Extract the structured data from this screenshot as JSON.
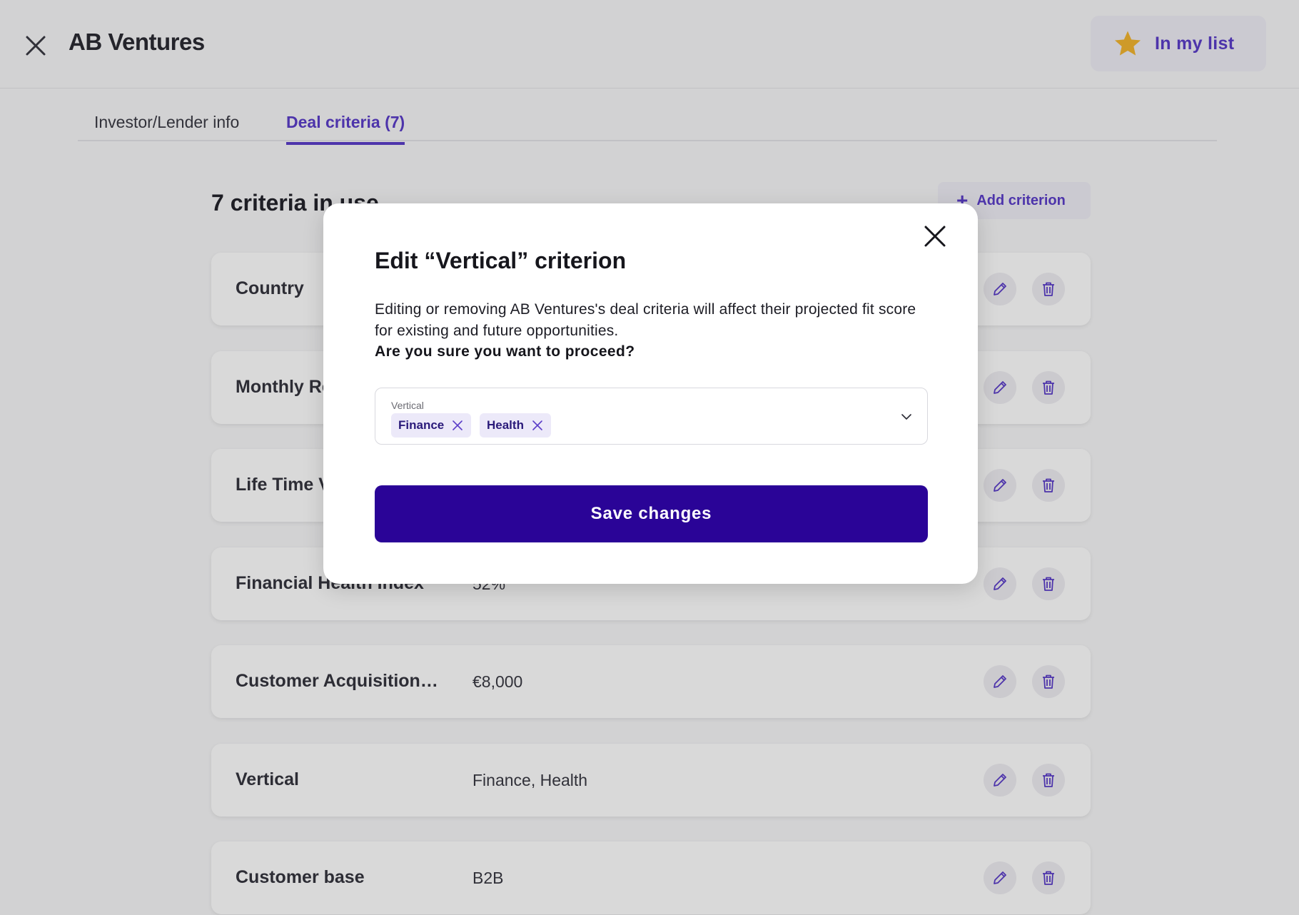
{
  "header": {
    "title": "AB Ventures",
    "my_list_label": "In my list"
  },
  "tabs": [
    {
      "label": "Investor/Lender info"
    },
    {
      "label": "Deal criteria (7)"
    }
  ],
  "content": {
    "count_title": "7 criteria in use",
    "add_criterion_label": "Add criterion"
  },
  "criteria": [
    {
      "name": "Country",
      "value": ""
    },
    {
      "name": "Monthly Recurring Revenue",
      "value": ""
    },
    {
      "name": "Life Time Value",
      "value": ""
    },
    {
      "name": "Financial Health Index",
      "value": "52%"
    },
    {
      "name": "Customer Acquisition…",
      "value": "€8,000"
    },
    {
      "name": "Vertical",
      "value": "Finance, Health"
    },
    {
      "name": "Customer base",
      "value": "B2B"
    }
  ],
  "modal": {
    "title": "Edit “Vertical” criterion",
    "description": "Editing or removing AB Ventures's deal criteria will affect their projected fit score for existing and future opportunities.",
    "question": "Are you sure you want to proceed?",
    "field_label": "Vertical",
    "chips": [
      "Finance",
      "Health"
    ],
    "save_label": "Save changes"
  },
  "colors": {
    "accent": "#5b3ec9",
    "primary_button": "#2a0497",
    "star": "#f2b631"
  }
}
